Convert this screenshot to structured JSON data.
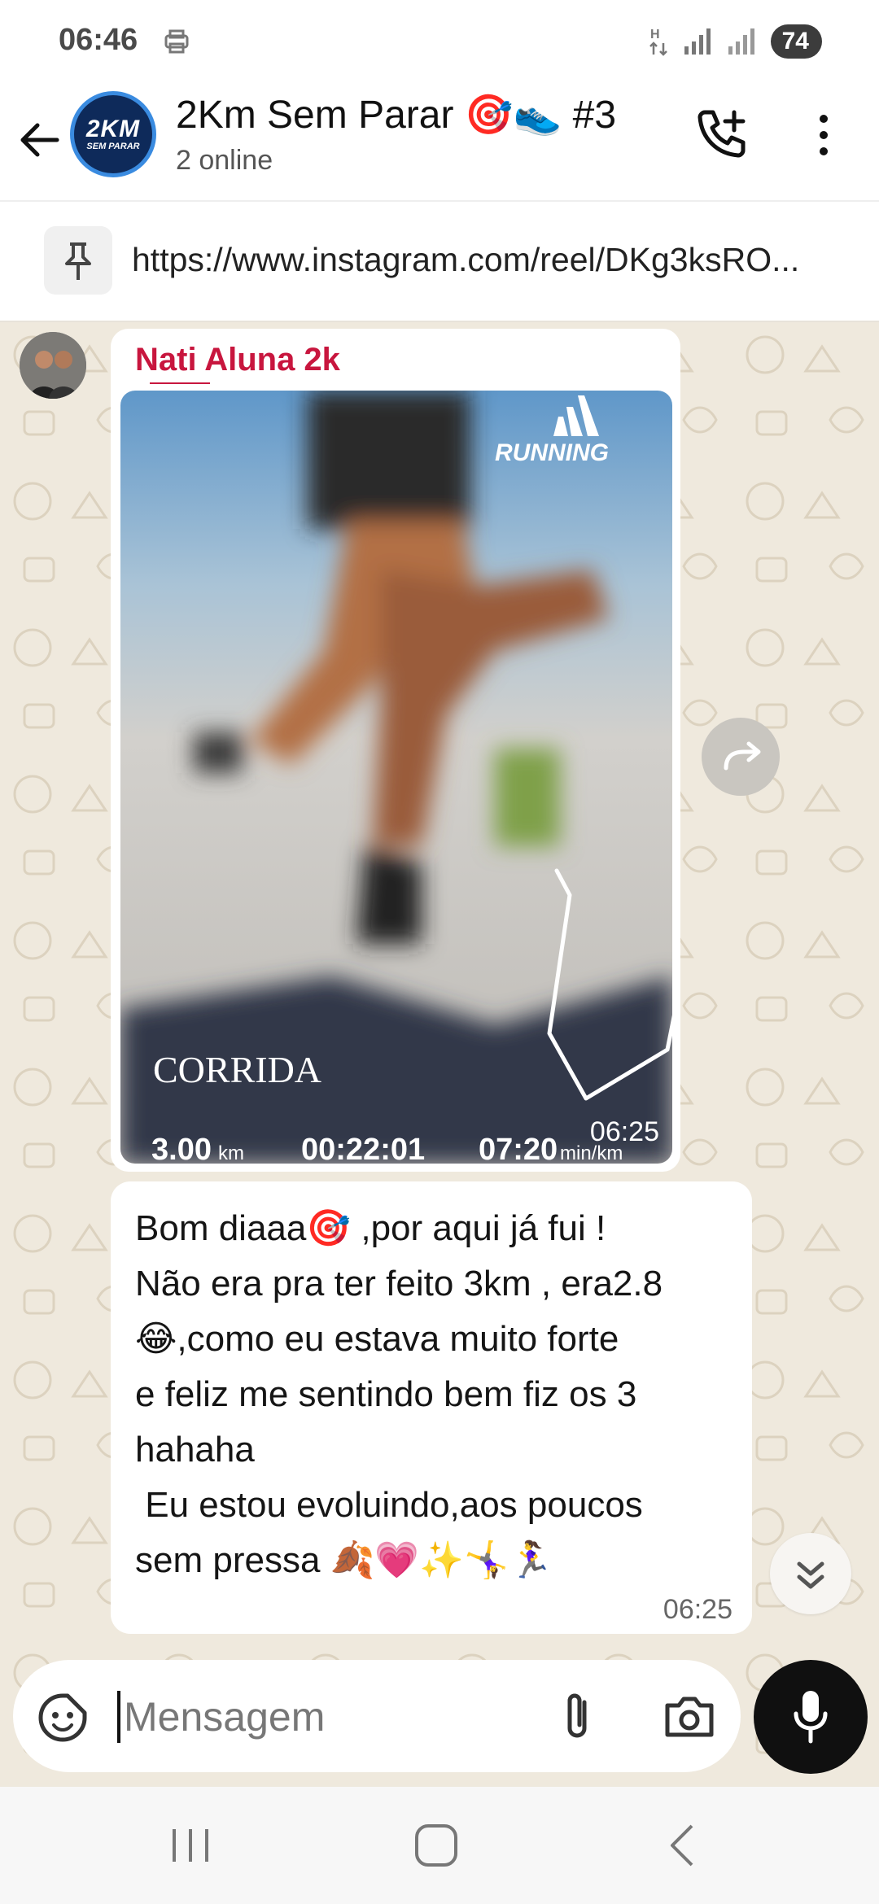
{
  "status_bar": {
    "time": "06:46",
    "battery": "74",
    "network_label": "H"
  },
  "header": {
    "group_avatar_big": "2KM",
    "group_avatar_small": "SEM PARAR",
    "title": "2Km Sem Parar 🎯👟 #3",
    "subtitle": "2 online"
  },
  "pinned": {
    "text": "https://www.instagram.com/reel/DKg3ksRO..."
  },
  "messages": [
    {
      "sender": "Nati Aluna 2k",
      "media": {
        "brand": "RUNNING",
        "activity": "CORRIDA",
        "distance": "3.00",
        "distance_unit": "km",
        "duration": "00:22:01",
        "pace": "07:20",
        "pace_unit": "min/km"
      },
      "time": "06:25"
    },
    {
      "text": "Bom diaaa🎯 ,por aqui já fui !\nNão era pra ter feito 3km , era2.8\n😂,como eu estava muito forte\ne feliz me sentindo bem fiz os 3\nhahaha\n Eu estou evoluindo,aos poucos\nsem pressa 🍂💗✨🤸‍♀️🏃‍♀️",
      "time": "06:25"
    }
  ],
  "composer": {
    "placeholder": "Mensagem"
  }
}
